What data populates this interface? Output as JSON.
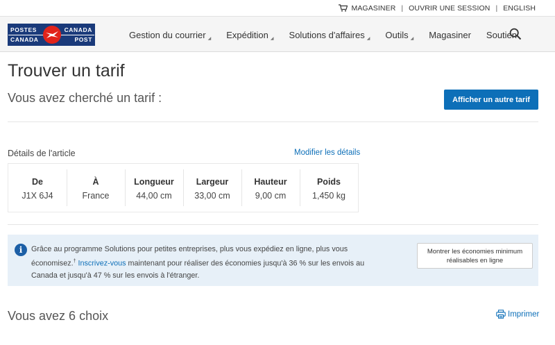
{
  "utility": {
    "shop": "MAGASINER",
    "login": "OUVRIR UNE SESSION",
    "lang": "ENGLISH"
  },
  "logo": {
    "line1_left": "POSTES",
    "line2_left": "CANADA",
    "line1_right": "CANADA",
    "line2_right": "POST"
  },
  "nav": {
    "items": [
      {
        "label": "Gestion du courrier",
        "dropdown": true
      },
      {
        "label": "Expédition",
        "dropdown": true
      },
      {
        "label": "Solutions d'affaires",
        "dropdown": true
      },
      {
        "label": "Outils",
        "dropdown": true
      },
      {
        "label": "Magasiner",
        "dropdown": false
      },
      {
        "label": "Soutien",
        "dropdown": false
      }
    ]
  },
  "page": {
    "title": "Trouver un tarif",
    "subtitle": "Vous avez cherché un tarif :",
    "other_rate_button": "Afficher un autre tarif"
  },
  "details": {
    "label": "Détails de l'article",
    "modify_link": "Modifier les détails",
    "columns": [
      {
        "header": "De",
        "value": "J1X 6J4"
      },
      {
        "header": "À",
        "value": "France"
      },
      {
        "header": "Longueur",
        "value": "44,00 cm"
      },
      {
        "header": "Largeur",
        "value": "33,00 cm"
      },
      {
        "header": "Hauteur",
        "value": "9,00 cm"
      },
      {
        "header": "Poids",
        "value": "1,450 kg"
      }
    ]
  },
  "info": {
    "text_part1": "Grâce au programme Solutions pour petites entreprises, plus vous expédiez en ligne, plus vous économisez.",
    "sup": "†",
    "link": "Inscrivez-vous",
    "text_part2": " maintenant pour réaliser des économies jusqu'à 36 % sur les envois au Canada et jusqu'à 47 % sur les envois à l'étranger.",
    "button": "Montrer les économies minimum réalisables en ligne"
  },
  "results": {
    "choices": "Vous avez 6 choix",
    "print": "Imprimer"
  },
  "colors": {
    "brand_blue": "#1a3a7a",
    "brand_red": "#e2231a",
    "link_blue": "#0d6fb8",
    "info_bg": "#e7f0f8"
  }
}
